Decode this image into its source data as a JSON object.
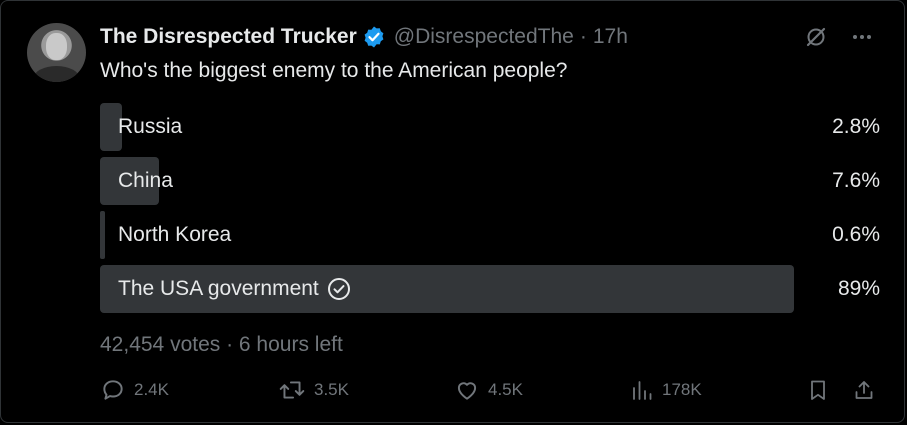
{
  "tweet": {
    "author_name": "The Disrespected Trucker",
    "handle": "@DisrespectedThe",
    "separator": "·",
    "time": "17h",
    "question": "Who's the biggest enemy to the American people?"
  },
  "poll": {
    "options": [
      {
        "label": "Russia",
        "percent_text": "2.8%",
        "percent": 2.8
      },
      {
        "label": "China",
        "percent_text": "7.6%",
        "percent": 7.6
      },
      {
        "label": "North Korea",
        "percent_text": "0.6%",
        "percent": 0.6
      },
      {
        "label": "The USA government",
        "percent_text": "89%",
        "percent": 89
      }
    ],
    "votes_text": "42,454 votes · 6 hours left"
  },
  "actions": {
    "replies": "2.4K",
    "reposts": "3.5K",
    "likes": "4.5K",
    "views": "178K"
  },
  "icons": [
    "verified-badge-icon",
    "grok-icon",
    "more-icon",
    "check-circle-icon",
    "reply-icon",
    "repost-icon",
    "like-icon",
    "views-icon",
    "bookmark-icon",
    "share-icon"
  ],
  "colors": {
    "verified": "#1d9bf0",
    "bar": "#333639",
    "muted": "#71767b",
    "text": "#e7e9ea",
    "background": "#000000"
  }
}
